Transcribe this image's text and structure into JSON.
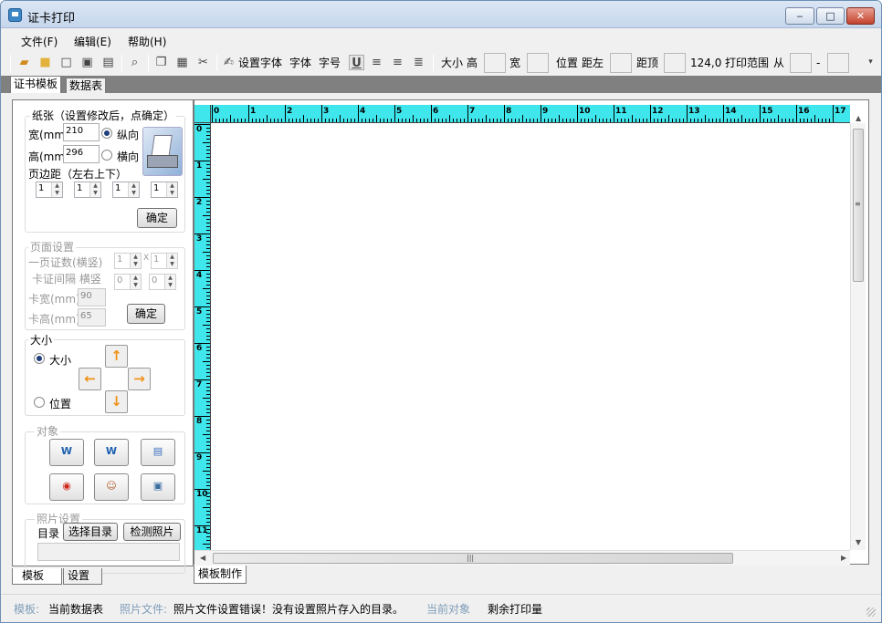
{
  "window": {
    "title": "证卡打印",
    "min_label": "‒",
    "max_label": "□",
    "close_label": "✕"
  },
  "menu": {
    "file": "文件(F)",
    "edit": "编辑(E)",
    "help": "帮助(H)"
  },
  "toolbar": {
    "font_setting": "设置字体",
    "font": "字体",
    "font_size": "字号",
    "underline": "U",
    "size_label": "大小",
    "height_label": "高",
    "width_label": "宽",
    "position_label": "位置",
    "left_label": "距左",
    "top_label": "距顶",
    "coords": "124,0",
    "print_range_label": "打印范围",
    "from_label": "从",
    "dash": "-"
  },
  "tabs": {
    "cert_template": "证书模板",
    "data_table": "数据表"
  },
  "paper": {
    "title": "纸张（设置修改后，点确定）",
    "width_label": "宽(mm)",
    "width_value": "210",
    "height_label": "高(mm)",
    "height_value": "296",
    "portrait": "纵向",
    "landscape": "横向",
    "margin_label": "页边距（左右上下）",
    "margins": [
      "1",
      "1",
      "1",
      "1"
    ],
    "confirm": "确定"
  },
  "page_setup": {
    "title": "页面设置",
    "count_label": "一页证数(横竖)",
    "count_h": "1",
    "count_v": "1",
    "x_sign": "X",
    "gap_label": "卡证间隔 横竖",
    "gap_h": "0",
    "gap_v": "0",
    "card_width_label": "卡宽(mm)",
    "card_width": "90",
    "card_height_label": "卡高(mm)",
    "card_height": "65",
    "confirm": "确定"
  },
  "size_group": {
    "title": "大小",
    "size": "大小",
    "position": "位置"
  },
  "objects": {
    "title": "对象",
    "btn1": "W",
    "btn2": "W",
    "btn3": "▤",
    "btn4": "◉",
    "btn5": "☺",
    "btn6": "▣"
  },
  "photo": {
    "title": "照片设置",
    "dir_label": "目录",
    "select_dir": "选择目录",
    "check_photo": "检测照片"
  },
  "bottom_tabs": {
    "template": "模板",
    "settings": "设置"
  },
  "ruler": {
    "h_numbers": [
      "0",
      "1",
      "2",
      "3",
      "4",
      "5",
      "6",
      "7",
      "8",
      "9",
      "10",
      "11",
      "12",
      "13",
      "14",
      "15",
      "16",
      "17"
    ],
    "v_numbers": [
      "0",
      "1",
      "2",
      "3",
      "4",
      "5",
      "6",
      "7",
      "8",
      "9",
      "10",
      "11"
    ]
  },
  "canvas_tab": "模板制作",
  "status": {
    "template_key": "模板:",
    "template_value": "当前数据表",
    "photo_key": "照片文件:",
    "photo_value": "照片文件设置错误！没有设置照片存入的目录。",
    "object_key": "当前对象",
    "remaining": "剩余打印量"
  }
}
